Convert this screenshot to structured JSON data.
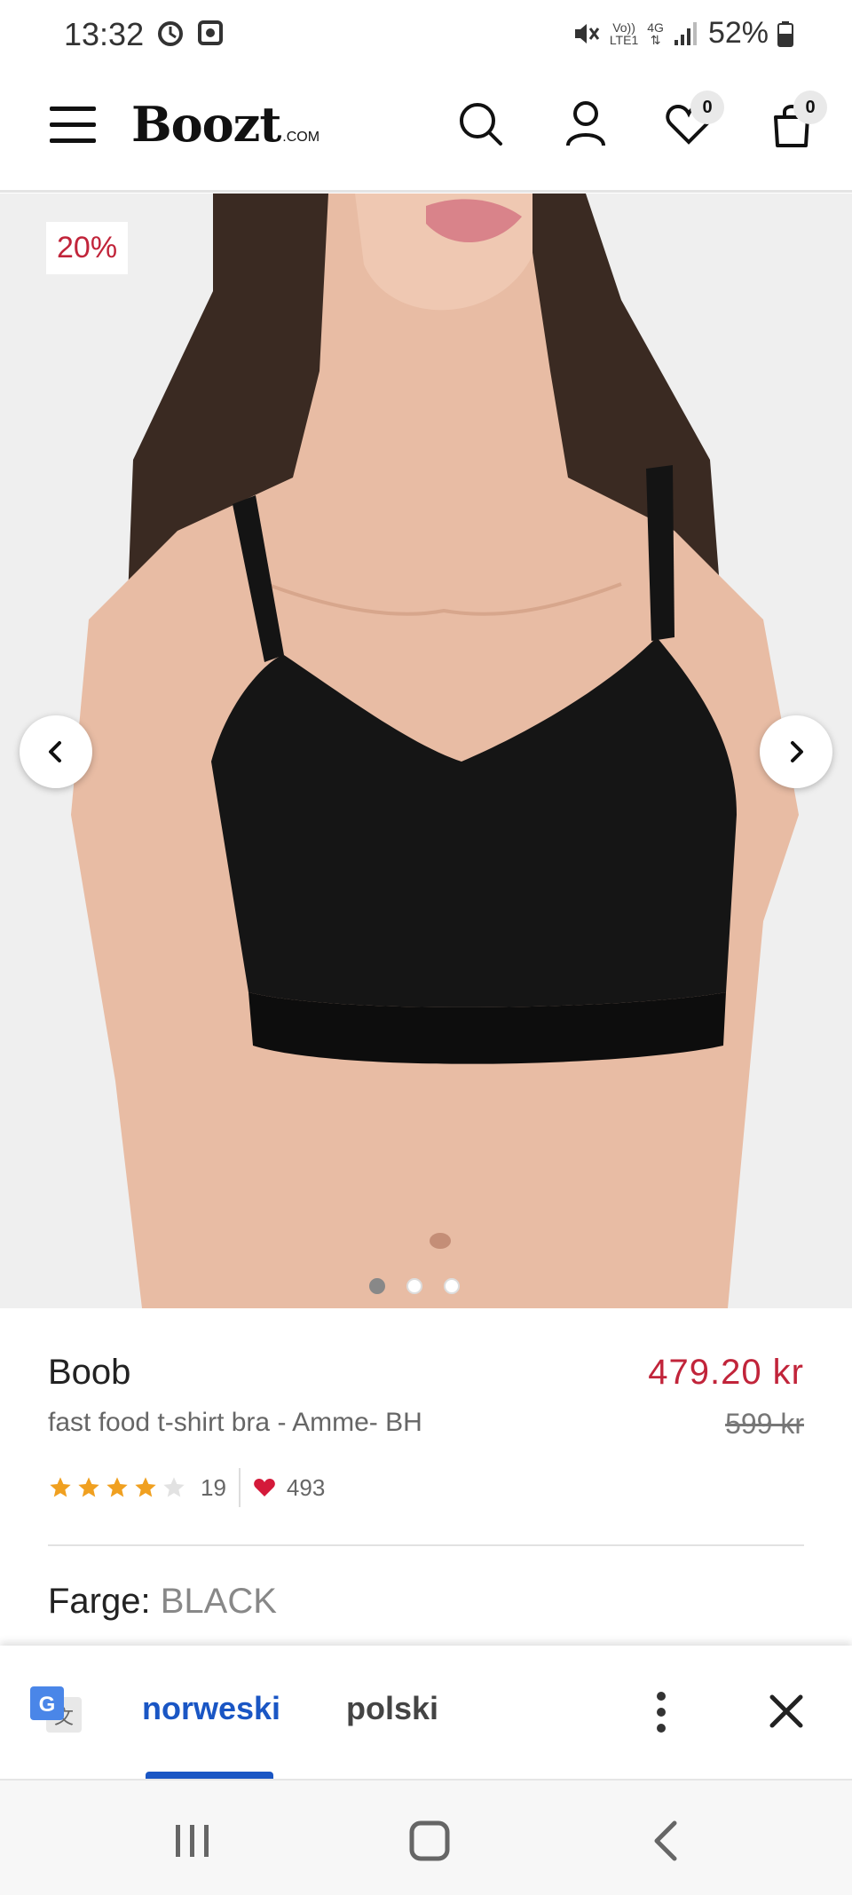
{
  "status_bar": {
    "time": "13:32",
    "volte": "Vo))",
    "lte": "LTE1",
    "network": "4G",
    "battery": "52%"
  },
  "header": {
    "logo": "Boozt",
    "logo_suffix": ".COM",
    "wishlist_count": "0",
    "cart_count": "0"
  },
  "gallery": {
    "discount": "20%",
    "image_count": 3,
    "active_index": 0
  },
  "product": {
    "brand": "Boob",
    "name": "fast food t-shirt bra - Amme- BH",
    "price": "479.20 kr",
    "original_price": "599 kr",
    "rating": 4,
    "rating_max": 5,
    "review_count": "19",
    "likes": "493",
    "color_label": "Farge:",
    "color_value": "BLACK"
  },
  "translate_bar": {
    "lang_from": "norweski",
    "lang_to": "polski"
  },
  "colors": {
    "accent_red": "#c1243a",
    "star": "#f0a020",
    "translate_blue": "#1a56c4"
  }
}
